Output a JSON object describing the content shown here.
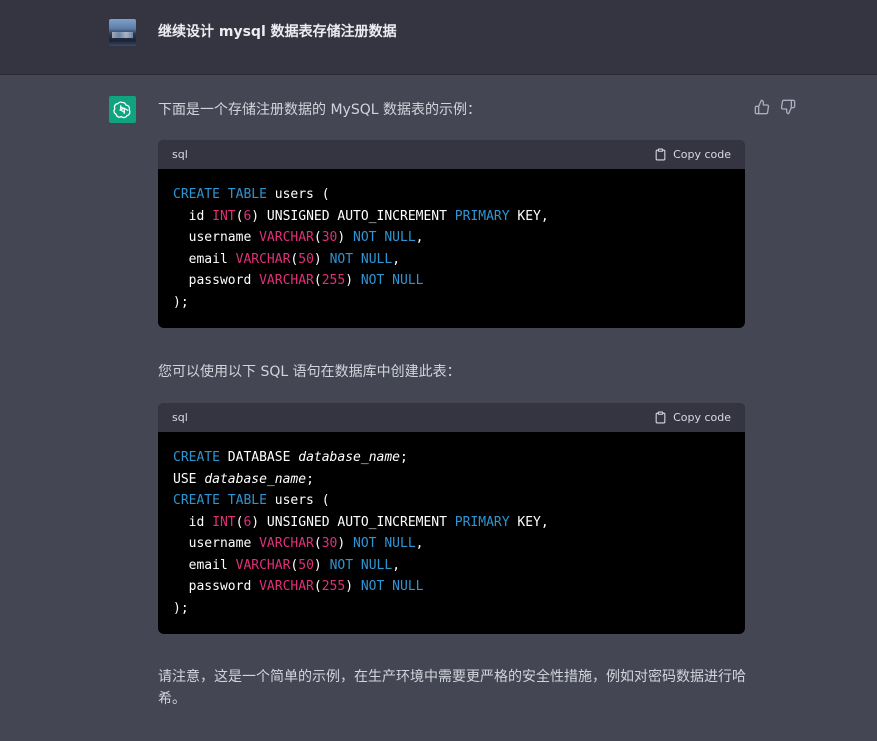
{
  "user_message": "继续设计 mysql 数据表存储注册数据",
  "assistant": {
    "intro": "下面是一个存储注册数据的 MySQL 数据表的示例：",
    "middle": "您可以使用以下 SQL 语句在数据库中创建此表：",
    "outro": "请注意，这是一个简单的示例，在生产环境中需要更严格的安全性措施，例如对密码数据进行哈希。"
  },
  "code_blocks": [
    {
      "language": "sql",
      "copy_label": "Copy code",
      "lines": [
        [
          {
            "t": "CREATE TABLE",
            "c": "kw"
          },
          {
            "t": " users (",
            "c": ""
          }
        ],
        [
          {
            "t": "  id ",
            "c": ""
          },
          {
            "t": "INT",
            "c": "ty"
          },
          {
            "t": "(",
            "c": ""
          },
          {
            "t": "6",
            "c": "nm"
          },
          {
            "t": ") UNSIGNED AUTO_INCREMENT ",
            "c": ""
          },
          {
            "t": "PRIMARY",
            "c": "kw"
          },
          {
            "t": " KEY,",
            "c": ""
          }
        ],
        [
          {
            "t": "  username ",
            "c": ""
          },
          {
            "t": "VARCHAR",
            "c": "ty"
          },
          {
            "t": "(",
            "c": ""
          },
          {
            "t": "30",
            "c": "nm"
          },
          {
            "t": ") ",
            "c": ""
          },
          {
            "t": "NOT NULL",
            "c": "kw"
          },
          {
            "t": ",",
            "c": ""
          }
        ],
        [
          {
            "t": "  email ",
            "c": ""
          },
          {
            "t": "VARCHAR",
            "c": "ty"
          },
          {
            "t": "(",
            "c": ""
          },
          {
            "t": "50",
            "c": "nm"
          },
          {
            "t": ") ",
            "c": ""
          },
          {
            "t": "NOT NULL",
            "c": "kw"
          },
          {
            "t": ",",
            "c": ""
          }
        ],
        [
          {
            "t": "  password ",
            "c": ""
          },
          {
            "t": "VARCHAR",
            "c": "ty"
          },
          {
            "t": "(",
            "c": ""
          },
          {
            "t": "255",
            "c": "nm"
          },
          {
            "t": ") ",
            "c": ""
          },
          {
            "t": "NOT NULL",
            "c": "kw"
          }
        ],
        [
          {
            "t": ");",
            "c": ""
          }
        ]
      ]
    },
    {
      "language": "sql",
      "copy_label": "Copy code",
      "lines": [
        [
          {
            "t": "CREATE",
            "c": "kw"
          },
          {
            "t": " DATABASE ",
            "c": ""
          },
          {
            "t": "database_name",
            "c": "it"
          },
          {
            "t": ";",
            "c": ""
          }
        ],
        [
          {
            "t": "USE ",
            "c": ""
          },
          {
            "t": "database_name",
            "c": "it"
          },
          {
            "t": ";",
            "c": ""
          }
        ],
        [
          {
            "t": "CREATE TABLE",
            "c": "kw"
          },
          {
            "t": " users (",
            "c": ""
          }
        ],
        [
          {
            "t": "  id ",
            "c": ""
          },
          {
            "t": "INT",
            "c": "ty"
          },
          {
            "t": "(",
            "c": ""
          },
          {
            "t": "6",
            "c": "nm"
          },
          {
            "t": ") UNSIGNED AUTO_INCREMENT ",
            "c": ""
          },
          {
            "t": "PRIMARY",
            "c": "kw"
          },
          {
            "t": " KEY,",
            "c": ""
          }
        ],
        [
          {
            "t": "  username ",
            "c": ""
          },
          {
            "t": "VARCHAR",
            "c": "ty"
          },
          {
            "t": "(",
            "c": ""
          },
          {
            "t": "30",
            "c": "nm"
          },
          {
            "t": ") ",
            "c": ""
          },
          {
            "t": "NOT NULL",
            "c": "kw"
          },
          {
            "t": ",",
            "c": ""
          }
        ],
        [
          {
            "t": "  email ",
            "c": ""
          },
          {
            "t": "VARCHAR",
            "c": "ty"
          },
          {
            "t": "(",
            "c": ""
          },
          {
            "t": "50",
            "c": "nm"
          },
          {
            "t": ") ",
            "c": ""
          },
          {
            "t": "NOT NULL",
            "c": "kw"
          },
          {
            "t": ",",
            "c": ""
          }
        ],
        [
          {
            "t": "  password ",
            "c": ""
          },
          {
            "t": "VARCHAR",
            "c": "ty"
          },
          {
            "t": "(",
            "c": ""
          },
          {
            "t": "255",
            "c": "nm"
          },
          {
            "t": ") ",
            "c": ""
          },
          {
            "t": "NOT NULL",
            "c": "kw"
          }
        ],
        [
          {
            "t": ");",
            "c": ""
          }
        ]
      ]
    }
  ],
  "icons": {
    "user_avatar": "user-avatar-image",
    "bot_avatar": "openai-logo-icon",
    "thumbs_up": "thumbs-up-icon",
    "thumbs_down": "thumbs-down-icon",
    "copy": "clipboard-icon"
  },
  "colors": {
    "page_bg": "#444654",
    "user_row_bg": "#343541",
    "bot_avatar_bg": "#10a37f",
    "code_bg": "#000000",
    "code_header_bg": "#343541",
    "keyword": "#2e95d3",
    "type_number": "#df3079"
  }
}
